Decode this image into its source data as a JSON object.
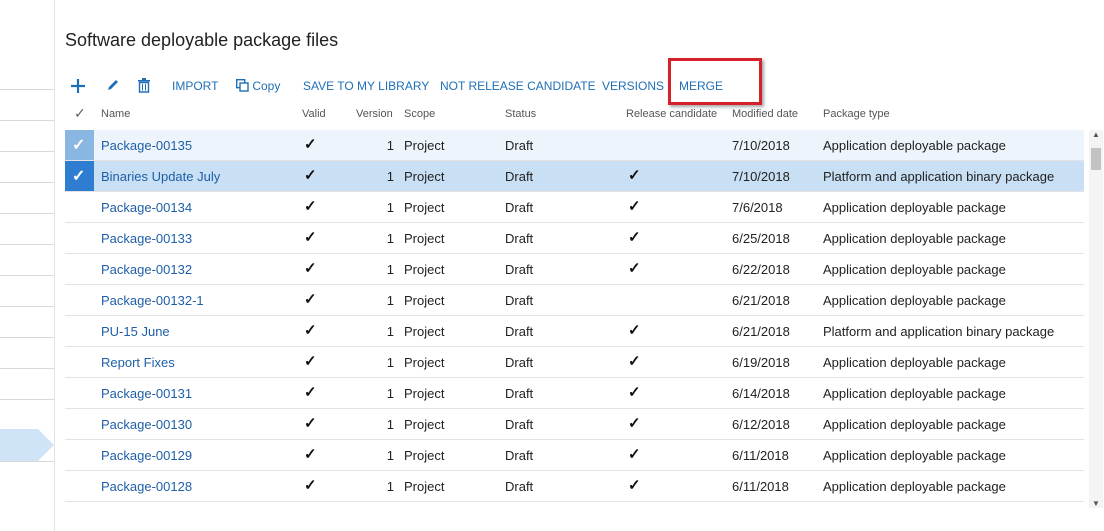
{
  "page": {
    "title": "Software deployable package files"
  },
  "toolbar": {
    "new_icon": "plus-icon",
    "edit_icon": "pencil-icon",
    "delete_icon": "trash-icon",
    "import_label": "IMPORT",
    "copy_icon": "copy-icon",
    "copy_label": "Copy",
    "save_library_label": "SAVE TO MY LIBRARY",
    "not_rc_label": "NOT RELEASE CANDIDATE",
    "versions_label": "VERSIONS",
    "merge_label": "MERGE",
    "accent_color": "#1f6fb7",
    "highlight_color": "#d6202a"
  },
  "grid": {
    "columns": {
      "select": "✓",
      "name": "Name",
      "valid": "Valid",
      "version": "Version",
      "scope": "Scope",
      "status": "Status",
      "release_candidate": "Release candidate",
      "modified_date": "Modified date",
      "package_type": "Package type"
    },
    "rows": [
      {
        "name": "Package-00135",
        "valid": true,
        "version": "1",
        "scope": "Project",
        "status": "Draft",
        "rc": false,
        "date": "7/10/2018",
        "type": "Application deployable package",
        "selected": true
      },
      {
        "name": "Binaries Update July",
        "valid": true,
        "version": "1",
        "scope": "Project",
        "status": "Draft",
        "rc": true,
        "date": "7/10/2018",
        "type": "Platform and application binary package",
        "selected": true
      },
      {
        "name": "Package-00134",
        "valid": true,
        "version": "1",
        "scope": "Project",
        "status": "Draft",
        "rc": true,
        "date": "7/6/2018",
        "type": "Application deployable package",
        "selected": false
      },
      {
        "name": "Package-00133",
        "valid": true,
        "version": "1",
        "scope": "Project",
        "status": "Draft",
        "rc": true,
        "date": "6/25/2018",
        "type": "Application deployable package",
        "selected": false
      },
      {
        "name": "Package-00132",
        "valid": true,
        "version": "1",
        "scope": "Project",
        "status": "Draft",
        "rc": true,
        "date": "6/22/2018",
        "type": "Application deployable package",
        "selected": false
      },
      {
        "name": "Package-00132-1",
        "valid": true,
        "version": "1",
        "scope": "Project",
        "status": "Draft",
        "rc": false,
        "date": "6/21/2018",
        "type": "Application deployable package",
        "selected": false
      },
      {
        "name": "PU-15 June",
        "valid": true,
        "version": "1",
        "scope": "Project",
        "status": "Draft",
        "rc": true,
        "date": "6/21/2018",
        "type": "Platform and application binary package",
        "selected": false
      },
      {
        "name": "Report Fixes",
        "valid": true,
        "version": "1",
        "scope": "Project",
        "status": "Draft",
        "rc": true,
        "date": "6/19/2018",
        "type": "Application deployable package",
        "selected": false
      },
      {
        "name": "Package-00131",
        "valid": true,
        "version": "1",
        "scope": "Project",
        "status": "Draft",
        "rc": true,
        "date": "6/14/2018",
        "type": "Application deployable package",
        "selected": false
      },
      {
        "name": "Package-00130",
        "valid": true,
        "version": "1",
        "scope": "Project",
        "status": "Draft",
        "rc": true,
        "date": "6/12/2018",
        "type": "Application deployable package",
        "selected": false
      },
      {
        "name": "Package-00129",
        "valid": true,
        "version": "1",
        "scope": "Project",
        "status": "Draft",
        "rc": true,
        "date": "6/11/2018",
        "type": "Application deployable package",
        "selected": false
      },
      {
        "name": "Package-00128",
        "valid": true,
        "version": "1",
        "scope": "Project",
        "status": "Draft",
        "rc": true,
        "date": "6/11/2018",
        "type": "Application deployable package",
        "selected": false
      }
    ]
  }
}
